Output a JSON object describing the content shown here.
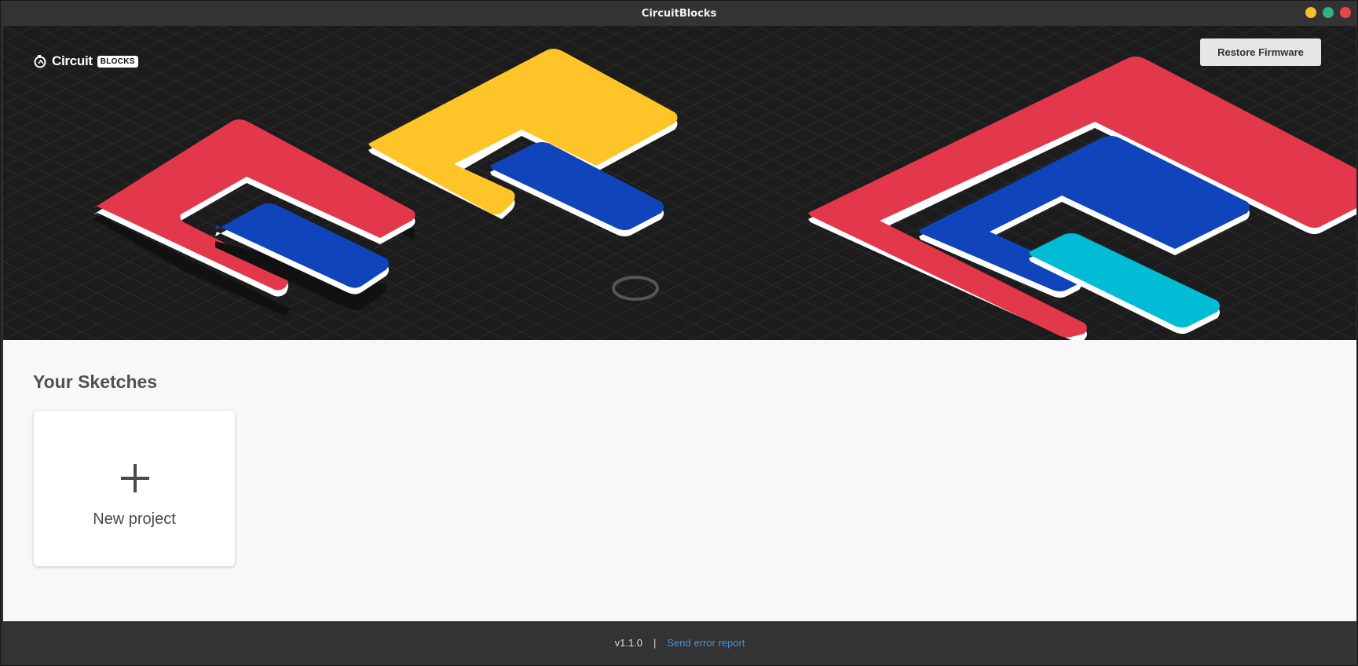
{
  "window": {
    "title": "CircuitBlocks",
    "controls": [
      {
        "name": "minimize",
        "color": "#f5c02a"
      },
      {
        "name": "maximize",
        "color": "#2eb28a"
      },
      {
        "name": "close",
        "color": "#e8454b"
      }
    ]
  },
  "header": {
    "logo_word": "Circuit",
    "logo_badge": "BLOCKS",
    "restore_button": "Restore Firmware",
    "loading_indicator": "spinner-ring"
  },
  "colors": {
    "red": "#e3374c",
    "yellow": "#fec428",
    "blue": "#0f44ba",
    "cyan": "#00bcd4",
    "hero_bg": "#1c1c1c",
    "link": "#4a90d9"
  },
  "sketches": {
    "title": "Your Sketches",
    "new_project": "New project",
    "new_icon": "plus-icon"
  },
  "footer": {
    "version": "v1.1.0",
    "separator": "|",
    "error_link": "Send error report"
  }
}
